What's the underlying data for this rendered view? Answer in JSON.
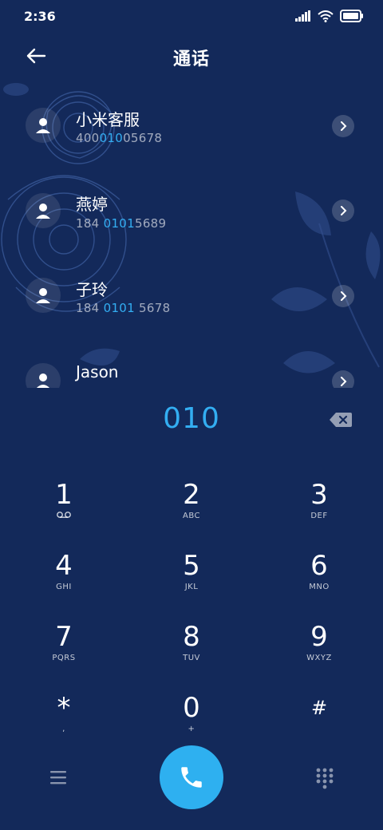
{
  "status_bar": {
    "time": "2:36",
    "icons": [
      "signal-icon",
      "wifi-icon",
      "battery-icon"
    ]
  },
  "header": {
    "title": "通话",
    "back_icon": "arrow-left-icon"
  },
  "contacts": [
    {
      "name": "小米客服",
      "number_parts": [
        "400",
        "010",
        "05678"
      ]
    },
    {
      "name": "燕婷",
      "number_parts": [
        "184 ",
        "0101",
        "5689"
      ]
    },
    {
      "name": "子玲",
      "number_parts": [
        "184 ",
        "0101",
        " 5678"
      ]
    },
    {
      "name": "Jason",
      "number_parts": [
        "",
        "",
        ""
      ]
    }
  ],
  "dialer": {
    "input": "010",
    "delete_icon": "backspace-icon",
    "keys": [
      {
        "digit": "1",
        "letters": ""
      },
      {
        "digit": "2",
        "letters": "ABC"
      },
      {
        "digit": "3",
        "letters": "DEF"
      },
      {
        "digit": "4",
        "letters": "GHI"
      },
      {
        "digit": "5",
        "letters": "JKL"
      },
      {
        "digit": "6",
        "letters": "MNO"
      },
      {
        "digit": "7",
        "letters": "PQRS"
      },
      {
        "digit": "8",
        "letters": "TUV"
      },
      {
        "digit": "9",
        "letters": "WXYZ"
      },
      {
        "digit": "*",
        "letters": ","
      },
      {
        "digit": "0",
        "letters": "+"
      },
      {
        "digit": "#",
        "letters": ""
      }
    ]
  },
  "bottom_bar": {
    "menu_icon": "menu-icon",
    "call_icon": "phone-icon",
    "dialpad_icon": "dialpad-icon"
  },
  "colors": {
    "background": "#13295a",
    "accent": "#33aef2",
    "call_button": "#2eb0f0"
  }
}
